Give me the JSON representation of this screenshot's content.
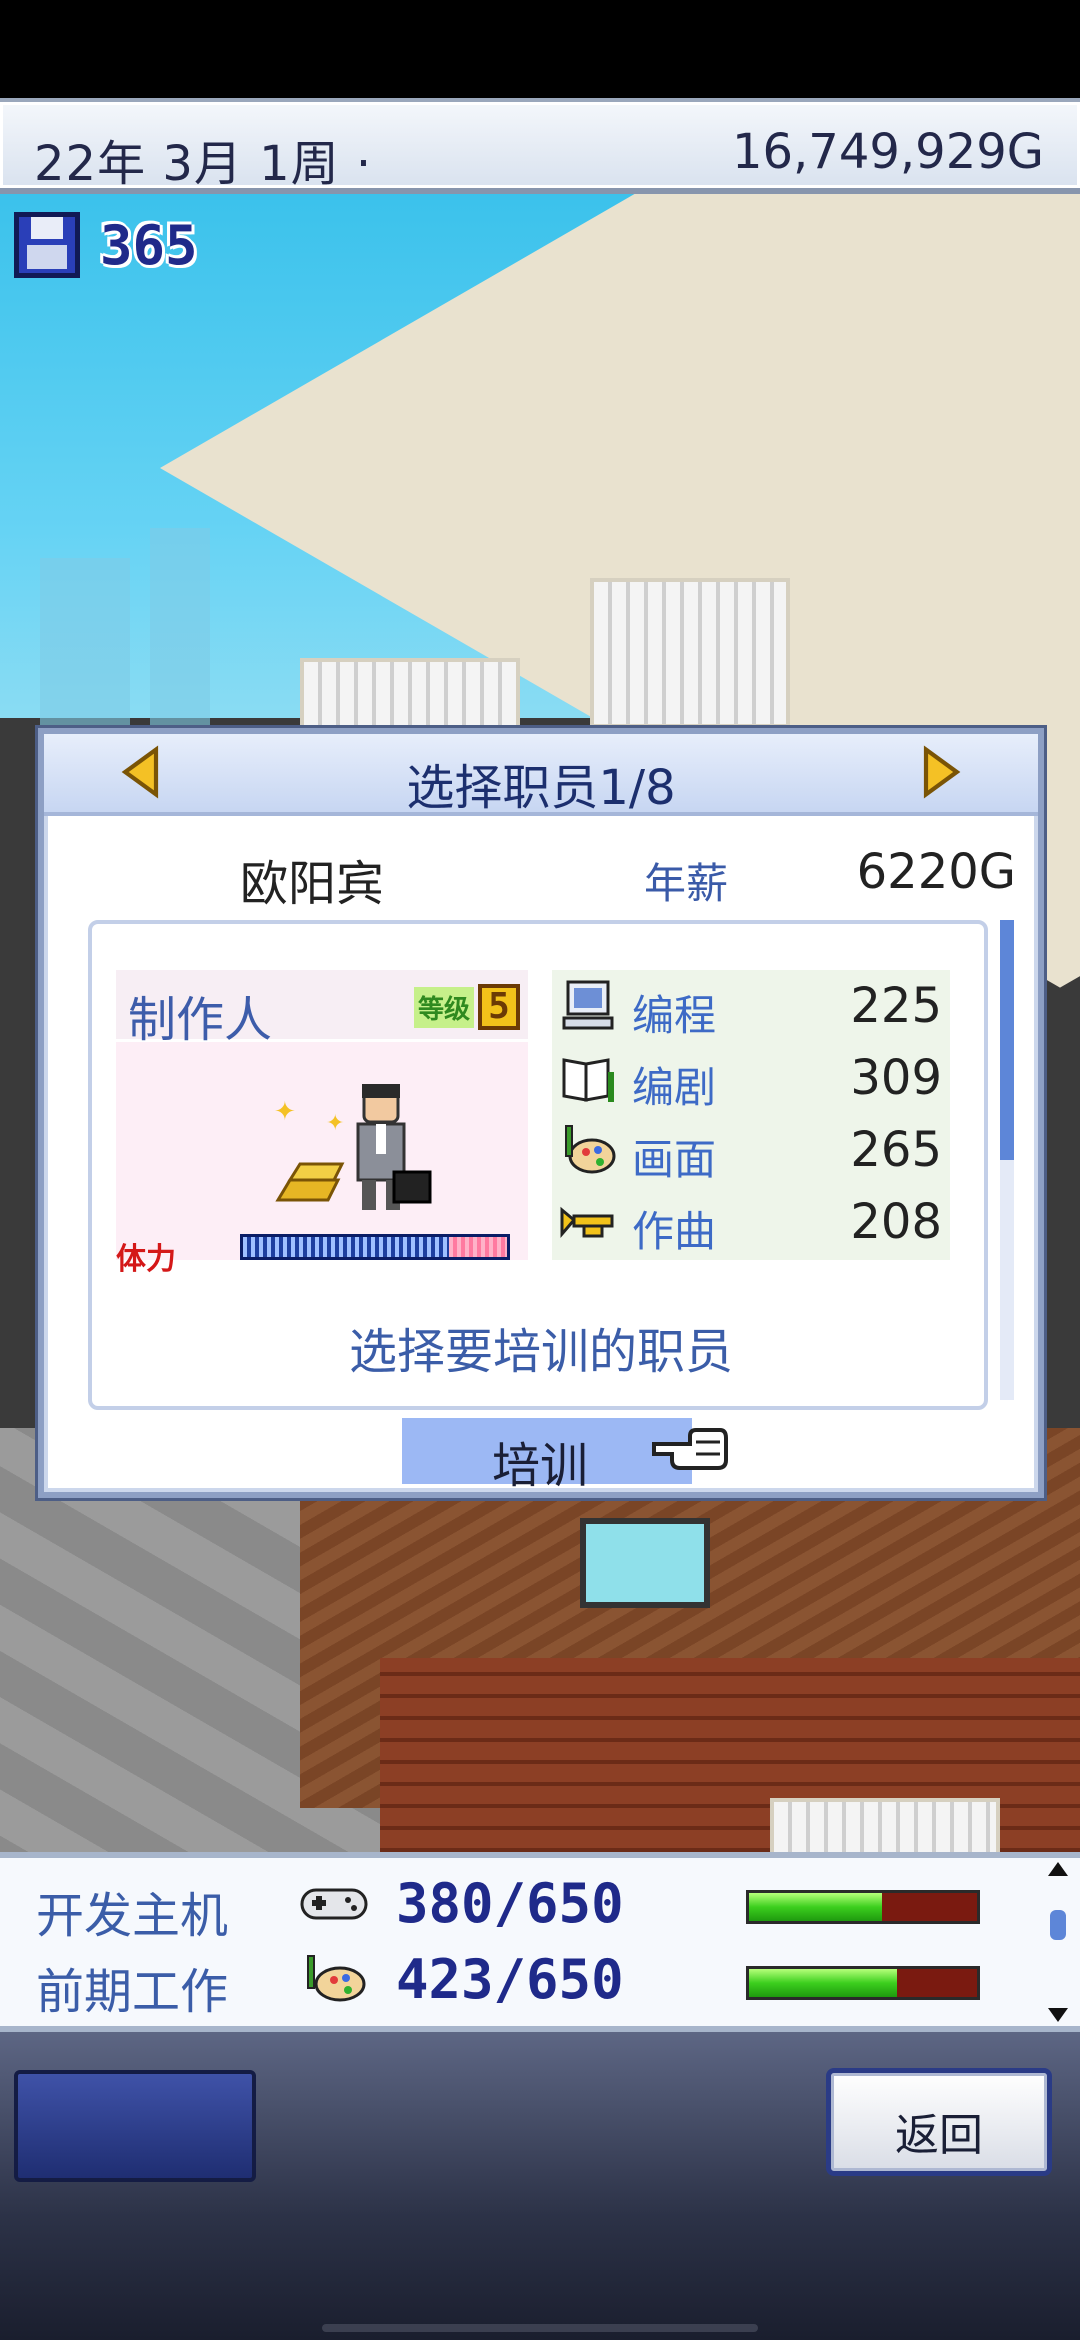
{
  "topbar": {
    "date": "22年 3月 1周 ·",
    "money": "16,749,929G"
  },
  "save": {
    "icon": "floppy-disk-icon",
    "count": "365"
  },
  "dialog": {
    "title": "选择职员1/8",
    "employee_name": "欧阳宾",
    "salary_label": "年薪",
    "salary_value": "6220G",
    "role": "制作人",
    "level_label": "等级",
    "level_value": "5",
    "stamina_label": "体力",
    "stamina_level": 0.78,
    "stats": [
      {
        "icon": "computer-icon",
        "label": "编程",
        "value": "225"
      },
      {
        "icon": "book-icon",
        "label": "编剧",
        "value": "309"
      },
      {
        "icon": "palette-icon",
        "label": "画面",
        "value": "265"
      },
      {
        "icon": "trumpet-icon",
        "label": "作曲",
        "value": "208"
      }
    ],
    "hint": "选择要培训的职员",
    "train_button": "培训"
  },
  "progress": [
    {
      "label": "开发主机",
      "icon": "gamepad-icon",
      "value": "380/650",
      "fraction": 0.585
    },
    {
      "label": "前期工作",
      "icon": "palette-icon",
      "value": "423/650",
      "fraction": 0.65
    }
  ],
  "bottombar": {
    "back_button": "返回"
  },
  "colors": {
    "accent_blue": "#3b5da8",
    "progress_green": "#3ccf1e",
    "stamina_red": "#d41818"
  }
}
